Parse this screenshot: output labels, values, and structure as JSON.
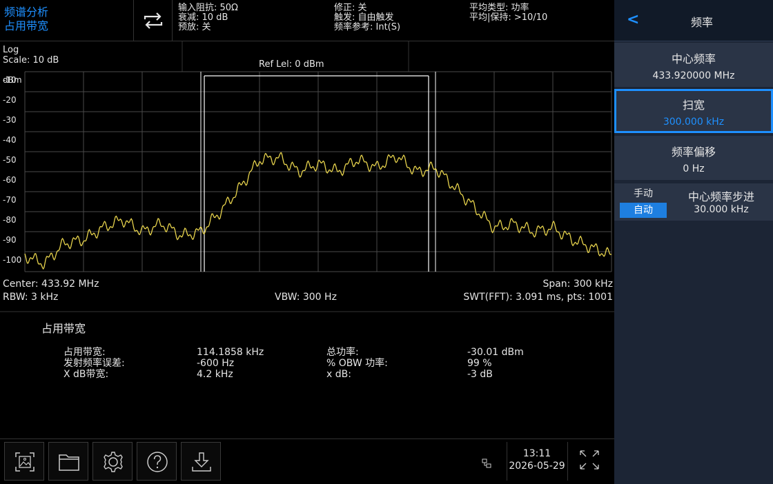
{
  "header": {
    "mode_line1": "频谱分析",
    "mode_line2": "占用带宽",
    "col1": [
      "输入阻抗: 50Ω",
      "衰减: 10 dB",
      "预放: 关"
    ],
    "col2": [
      "修正: 关",
      "触发: 自由触发",
      "频率参考: Int(S)"
    ],
    "col3": [
      "平均类型: 功率",
      "平均|保持: >10/10"
    ]
  },
  "graph": {
    "scale_mode": "Log",
    "scale": "Scale: 10 dB",
    "ref_level": "Ref Lel: 0 dBm",
    "unit": "dBm",
    "y_ticks": [
      "-10",
      "-20",
      "-30",
      "-40",
      "-50",
      "-60",
      "-70",
      "-80",
      "-90",
      "-100"
    ],
    "center": "Center: 433.92 MHz",
    "span": "Span: 300 kHz",
    "rbw": "RBW: 3 kHz",
    "vbw": "VBW: 300 Hz",
    "swt": "SWT(FFT): 3.091 ms, pts: 1001",
    "trace_color": "#e8d44d"
  },
  "chart_data": {
    "type": "line",
    "x": [
      -150,
      -140,
      -130,
      -120,
      -110,
      -100,
      -90,
      -80,
      -70,
      -60,
      -50,
      -40,
      -30,
      -20,
      -10,
      0,
      10,
      20,
      30,
      40,
      50,
      60,
      70,
      80,
      90,
      100,
      110,
      120,
      130,
      140,
      150
    ],
    "series": [
      {
        "values": [
          -92,
          -96,
          -86,
          -84,
          -78,
          -74,
          -80,
          -76,
          -82,
          -80,
          -70,
          -58,
          -44,
          -43,
          -50,
          -46,
          -50,
          -44,
          -48,
          -42,
          -50,
          -48,
          -58,
          -68,
          -78,
          -76,
          -80,
          -78,
          -84,
          -88,
          -92
        ]
      }
    ],
    "xlim": [
      -150,
      150
    ],
    "ylim": [
      -100,
      0
    ]
  },
  "results": {
    "title": "占用带宽",
    "rows": [
      {
        "label": "占用带宽:",
        "value": "114.1858 kHz",
        "label2": "总功率:",
        "value2": "-30.01 dBm"
      },
      {
        "label": "发射频率误差:",
        "value": "-600 Hz",
        "label2": "% OBW 功率:",
        "value2": "99 %"
      },
      {
        "label": "X dB带宽:",
        "value": "4.2 kHz",
        "label2": "x dB:",
        "value2": "-3 dB"
      }
    ]
  },
  "toolbar": {
    "time": "13:11",
    "date": "2026-05-29",
    "icons": [
      "screenshot-icon",
      "folder-icon",
      "settings-icon",
      "help-icon",
      "download-icon",
      "network-icon",
      "fullscreen-icon"
    ]
  },
  "panel": {
    "back_label": "<",
    "title": "频率",
    "items": [
      {
        "title": "中心频率",
        "value": "433.920000 MHz"
      },
      {
        "title": "扫宽",
        "value": "300.000 kHz"
      },
      {
        "title": "频率偏移",
        "value": "0 Hz"
      }
    ],
    "step": {
      "manual": "手动",
      "auto": "自动",
      "title": "中心频率步进",
      "value": "30.000 kHz"
    },
    "accent": "#1e90ff"
  }
}
